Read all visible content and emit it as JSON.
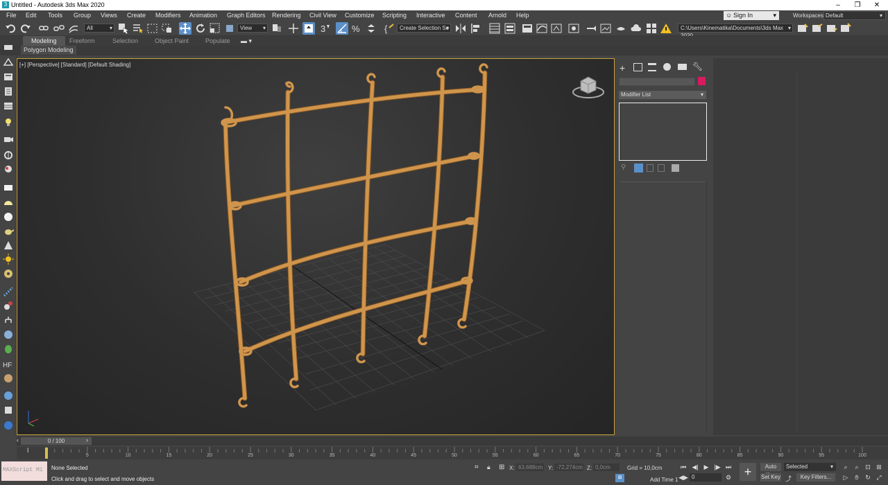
{
  "window": {
    "title": "Untitled - Autodesk 3ds Max 2020"
  },
  "menu": [
    "File",
    "Edit",
    "Tools",
    "Group",
    "Views",
    "Create",
    "Modifiers",
    "Animation",
    "Graph Editors",
    "Rendering",
    "Civil View",
    "Customize",
    "Scripting",
    "Interactive",
    "Content",
    "Arnold",
    "Help"
  ],
  "account": {
    "sign_in": "Sign In",
    "workspaces_label": "Workspaces:",
    "workspace_value": "Default"
  },
  "toolbar": {
    "filter_value": "All",
    "refcoord_value": "View",
    "selection_set_placeholder": "Create Selection Se",
    "project_path": "C:\\Users\\Kinematika\\Documents\\3ds Max 2020"
  },
  "ribbon": {
    "tabs": [
      "Modeling",
      "Freeform",
      "Selection",
      "Object Paint",
      "Populate"
    ],
    "active_tab": "Modeling",
    "panel_label": "Polygon Modeling"
  },
  "viewport": {
    "label": "[+] [Perspective] [Standard] [Default Shading]",
    "object_color": "#d0954c"
  },
  "command_panel": {
    "modifier_list": "Modifier List",
    "object_color": "#d81b60"
  },
  "time_slider": {
    "value": "0 / 100"
  },
  "trackbar": {
    "ticks": [
      0,
      5,
      10,
      15,
      20,
      25,
      30,
      35,
      40,
      45,
      50,
      55,
      60,
      65,
      70,
      75,
      80,
      85,
      90,
      95,
      100
    ]
  },
  "status": {
    "maxscript": "MAXScript Mi",
    "selection": "None Selected",
    "prompt": "Click and drag to select and move objects",
    "x_label": "X:",
    "x_value": "63,688cm",
    "y_label": "Y:",
    "y_value": "-72,274cm",
    "z_label": "Z:",
    "z_value": "0,0cm",
    "grid": "Grid = 10,0cm",
    "add_time": "Add Time 1"
  },
  "anim": {
    "frame": "0",
    "auto_key": "Auto Key",
    "set_key": "Set Key",
    "selected": "Selected",
    "key_filters": "Key Filters..."
  }
}
